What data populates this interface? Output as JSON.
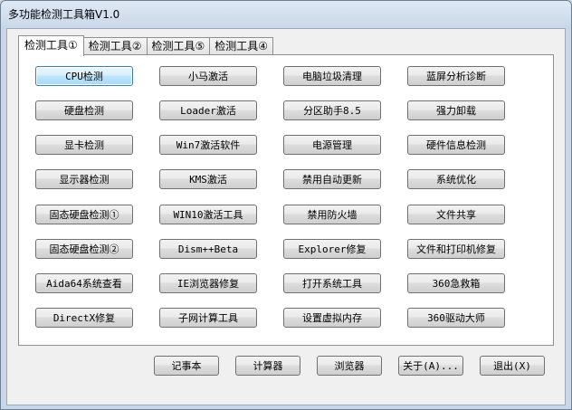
{
  "window": {
    "title": "多功能检测工具箱V1.0"
  },
  "tabs": [
    {
      "label": "检测工具①",
      "active": true
    },
    {
      "label": "检测工具②",
      "active": false
    },
    {
      "label": "检测工具⑤",
      "active": false
    },
    {
      "label": "检测工具④",
      "active": false
    }
  ],
  "tools": [
    {
      "label": "CPU检测",
      "name": "cpu-check",
      "focused": true
    },
    {
      "label": "小马激活",
      "name": "xiaoma-activate"
    },
    {
      "label": "电脑垃圾清理",
      "name": "junk-cleanup"
    },
    {
      "label": "蓝屏分析诊断",
      "name": "bluescreen-diagnose"
    },
    {
      "label": "硬盘检测",
      "name": "disk-check"
    },
    {
      "label": "Loader激活",
      "name": "loader-activate"
    },
    {
      "label": "分区助手8.5",
      "name": "partition-assistant"
    },
    {
      "label": "强力卸载",
      "name": "force-uninstall"
    },
    {
      "label": "显卡检测",
      "name": "gpu-check"
    },
    {
      "label": "Win7激活软件",
      "name": "win7-activate"
    },
    {
      "label": "电源管理",
      "name": "power-management"
    },
    {
      "label": "硬件信息检测",
      "name": "hardware-info"
    },
    {
      "label": "显示器检测",
      "name": "monitor-check"
    },
    {
      "label": "KMS激活",
      "name": "kms-activate"
    },
    {
      "label": "禁用自动更新",
      "name": "disable-auto-update"
    },
    {
      "label": "系统优化",
      "name": "system-optimize"
    },
    {
      "label": "固态硬盘检测①",
      "name": "ssd-check-1"
    },
    {
      "label": "WIN10激活工具",
      "name": "win10-activate"
    },
    {
      "label": "禁用防火墙",
      "name": "disable-firewall"
    },
    {
      "label": "文件共享",
      "name": "file-sharing"
    },
    {
      "label": "固态硬盘检测②",
      "name": "ssd-check-2"
    },
    {
      "label": "Dism++Beta",
      "name": "dism-beta"
    },
    {
      "label": "Explorer修复",
      "name": "explorer-repair"
    },
    {
      "label": "文件和打印机修复",
      "name": "file-printer-repair"
    },
    {
      "label": "Aida64系统查看",
      "name": "aida64-view"
    },
    {
      "label": "IE浏览器修复",
      "name": "ie-repair"
    },
    {
      "label": "打开系统工具",
      "name": "open-system-tools"
    },
    {
      "label": "360急救箱",
      "name": "360-rescue"
    },
    {
      "label": "DirectX修复",
      "name": "directx-repair"
    },
    {
      "label": "子网计算工具",
      "name": "subnet-calculator"
    },
    {
      "label": "设置虚拟内存",
      "name": "virtual-memory"
    },
    {
      "label": "360驱动大师",
      "name": "360-driver-master"
    }
  ],
  "bottom_buttons": [
    {
      "label": "记事本",
      "name": "notepad"
    },
    {
      "label": "计算器",
      "name": "calculator"
    },
    {
      "label": "浏览器",
      "name": "browser"
    },
    {
      "label": "关于(A)...",
      "name": "about"
    },
    {
      "label": "退出(X)",
      "name": "exit"
    }
  ]
}
